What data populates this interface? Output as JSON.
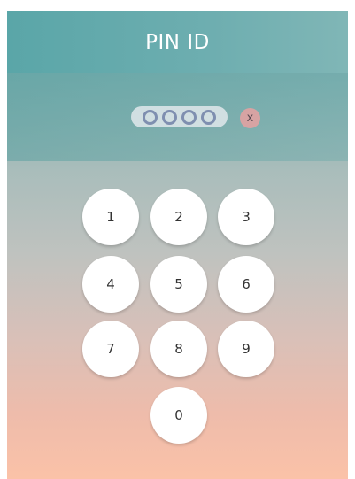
{
  "header": {
    "title": "PIN ID"
  },
  "pin": {
    "digit_count": 4,
    "clear_label": "x"
  },
  "keypad": {
    "keys": [
      "1",
      "2",
      "3",
      "4",
      "5",
      "6",
      "7",
      "8",
      "9",
      "0"
    ]
  }
}
